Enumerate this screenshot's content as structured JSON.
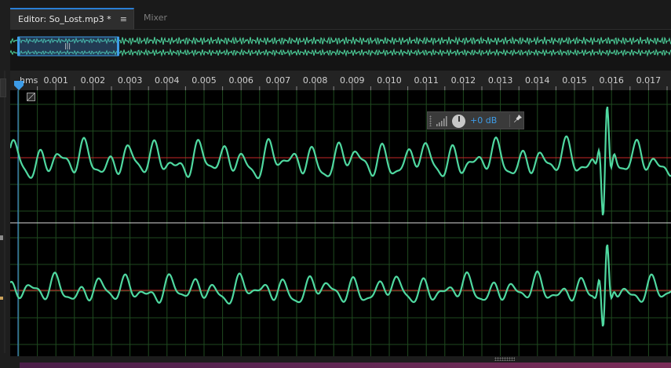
{
  "tabs": [
    {
      "label": "Editor: So_Lost.mp3 *",
      "active": true,
      "menu_icon": "≡"
    },
    {
      "label": "Mixer",
      "active": false
    }
  ],
  "ruler": {
    "unit_label": "hms",
    "ticks": [
      "0.001",
      "0.002",
      "0.003",
      "0.004",
      "0.005",
      "0.006",
      "0.007",
      "0.008",
      "0.009",
      "0.010",
      "0.011",
      "0.012",
      "0.013",
      "0.014",
      "0.015",
      "0.016",
      "0.017"
    ]
  },
  "hud": {
    "gain_label": "+0 dB"
  },
  "colors": {
    "waveform": "#4fd8a0",
    "centerline": "#c62828",
    "grid": "#1f4a1f",
    "accent": "#2a7fd6"
  }
}
